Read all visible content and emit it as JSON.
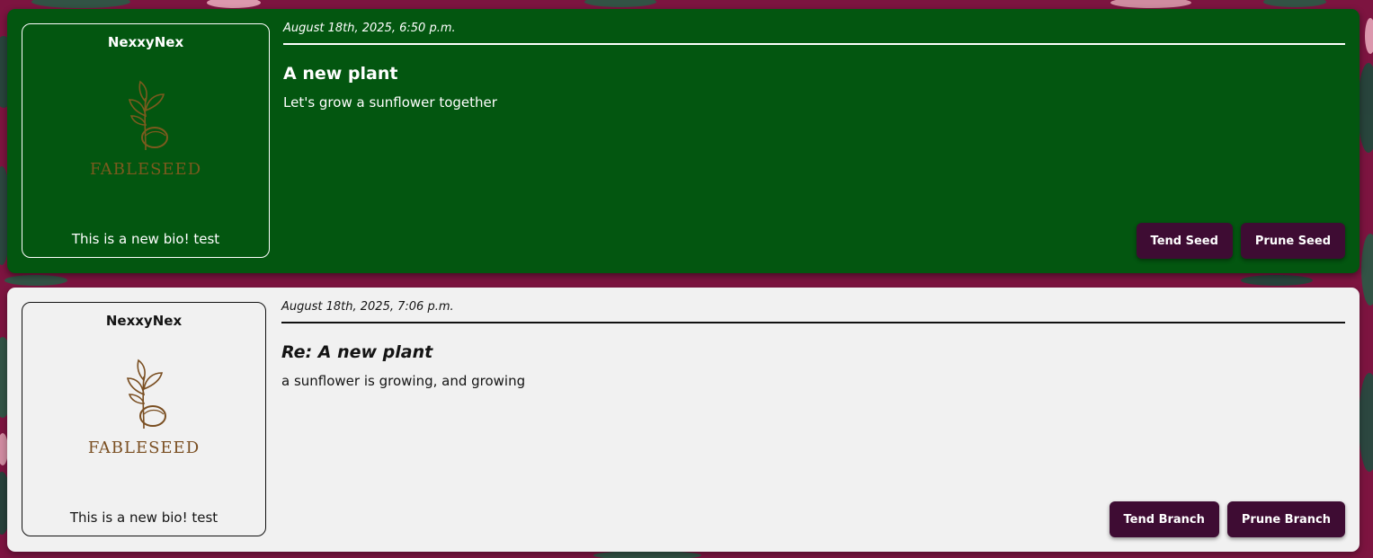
{
  "theme": {
    "background": "#7d1440",
    "post_color": "#035610",
    "reply_color": "#f1f1f1",
    "button_color": "#3e0c33"
  },
  "post": {
    "author": {
      "username": "NexxyNex",
      "logo_text": "FABLESEED",
      "logo_icon": "seed-sprout-icon",
      "bio": "This is a new bio! test"
    },
    "timestamp": "August 18th, 2025, 6:50 p.m.",
    "title": "A new plant",
    "body": "Let's grow a sunflower together",
    "actions": {
      "tend_label": "Tend Seed",
      "prune_label": "Prune Seed"
    }
  },
  "reply": {
    "author": {
      "username": "NexxyNex",
      "logo_text": "FABLESEED",
      "logo_icon": "seed-sprout-icon",
      "bio": "This is a new bio! test"
    },
    "timestamp": "August 18th, 2025, 7:06 p.m.",
    "title": "Re: A new plant",
    "body": "a sunflower is growing, and growing",
    "actions": {
      "tend_label": "Tend Branch",
      "prune_label": "Prune Branch"
    }
  }
}
